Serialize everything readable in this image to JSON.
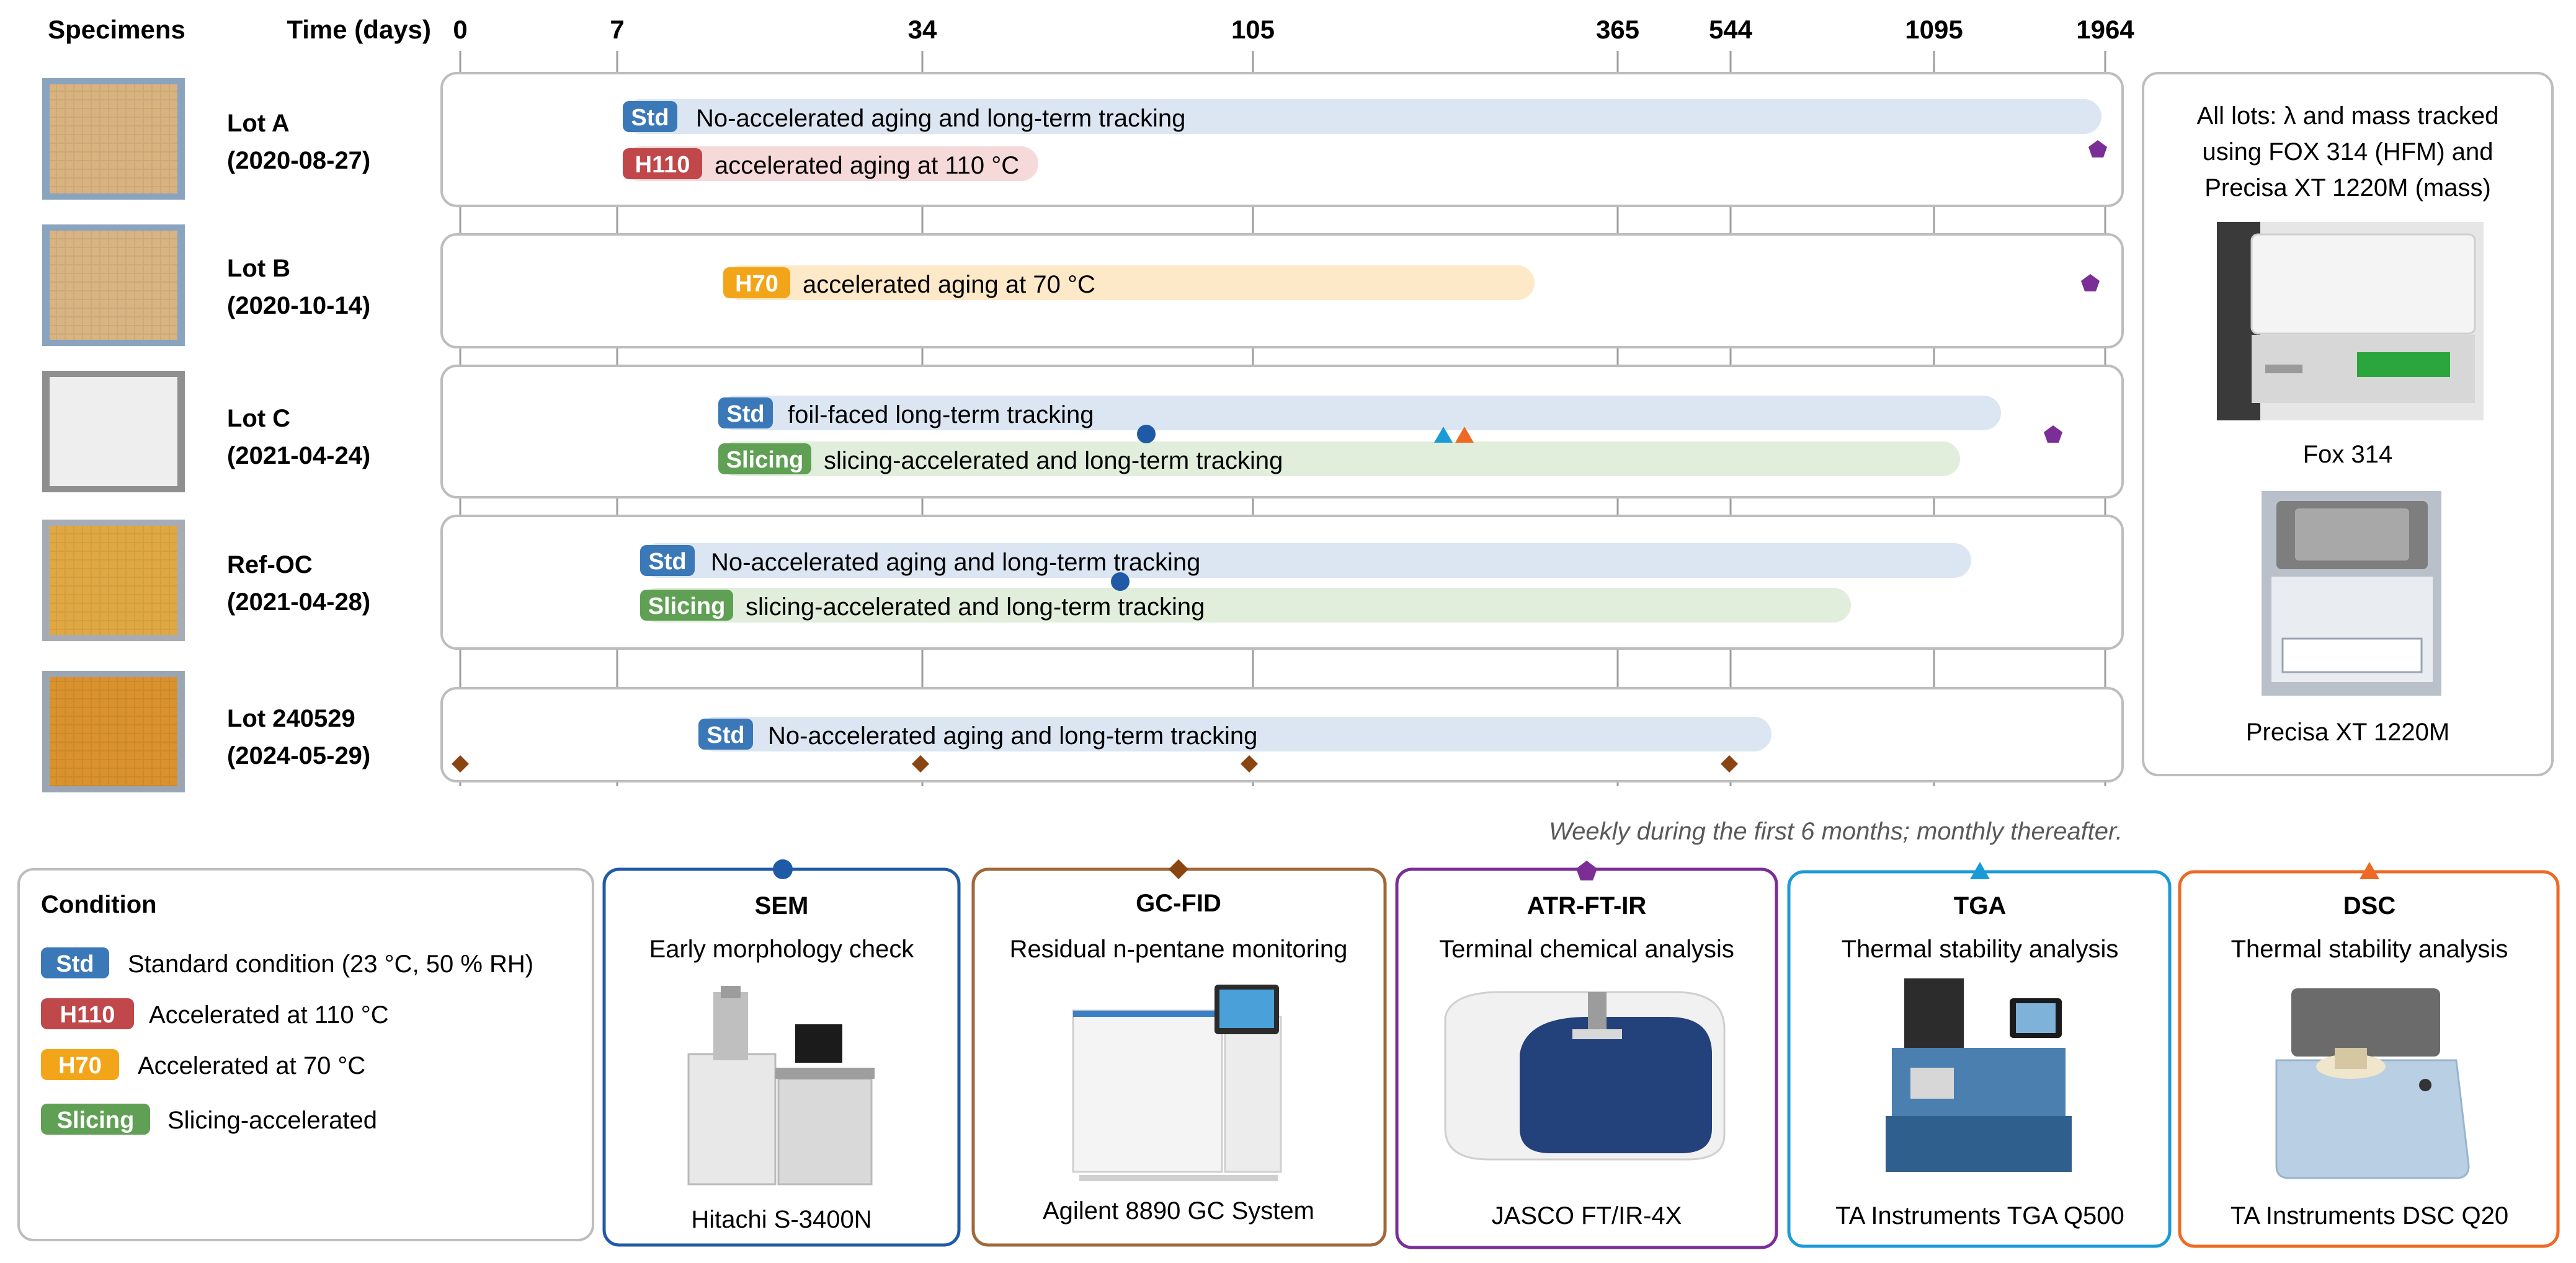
{
  "header": {
    "specimens": "Specimens",
    "time": "Time (days)"
  },
  "ticks": [
    "0",
    "7",
    "34",
    "105",
    "365",
    "544",
    "1095",
    "1964"
  ],
  "lots": [
    {
      "name": "Lot A",
      "date": "(2020-08-27)",
      "tracks": [
        {
          "badge": "Std",
          "label": "No-accelerated aging and long-term tracking"
        },
        {
          "badge": "H110",
          "label": "accelerated aging at 110 °C"
        }
      ]
    },
    {
      "name": "Lot B",
      "date": "(2020-10-14)",
      "tracks": [
        {
          "badge": "H70",
          "label": "accelerated aging at 70 °C"
        }
      ]
    },
    {
      "name": "Lot C",
      "date": "(2021-04-24)",
      "tracks": [
        {
          "badge": "Std",
          "label": "foil-faced long-term tracking"
        },
        {
          "badge": "Slicing",
          "label": "slicing-accelerated and long-term tracking"
        }
      ]
    },
    {
      "name": "Ref-OC",
      "date": "(2021-04-28)",
      "tracks": [
        {
          "badge": "Std",
          "label": "No-accelerated aging and long-term tracking"
        },
        {
          "badge": "Slicing",
          "label": "slicing-accelerated and long-term tracking"
        }
      ]
    },
    {
      "name": "Lot 240529",
      "date": "(2024-05-29)",
      "tracks": [
        {
          "badge": "Std",
          "label": "No-accelerated aging and long-term tracking"
        }
      ]
    }
  ],
  "gc_note": "Weekly during the first 6 months; monthly thereafter.",
  "side_panel": {
    "text": [
      "All lots: λ and mass tracked",
      "using FOX 314 (HFM) and",
      "Precisa XT 1220M (mass)"
    ],
    "inst1": "Fox 314",
    "inst2": "Precisa XT 1220M"
  },
  "legend": {
    "title": "Condition",
    "items": [
      {
        "badge": "Std",
        "label": "Standard condition (23 °C, 50 % RH)"
      },
      {
        "badge": "H110",
        "label": "Accelerated at 110 °C"
      },
      {
        "badge": "H70",
        "label": "Accelerated at 70 °C"
      },
      {
        "badge": "Slicing",
        "label": "Slicing-accelerated"
      }
    ]
  },
  "instruments": [
    {
      "title": "SEM",
      "desc": "Early morphology check",
      "model": "Hitachi S-3400N",
      "icon": "circle-marker-icon",
      "color": "#1f5aa6"
    },
    {
      "title": "GC-FID",
      "desc": "Residual n-pentane monitoring",
      "model": "Agilent 8890 GC System",
      "icon": "diamond-marker-icon",
      "color": "#8b4513"
    },
    {
      "title": "ATR-FT-IR",
      "desc": "Terminal chemical analysis",
      "model": "JASCO FT/IR-4X",
      "icon": "pentagon-marker-icon",
      "color": "#7b2e96"
    },
    {
      "title": "TGA",
      "desc": "Thermal stability analysis",
      "model": "TA Instruments TGA Q500",
      "icon": "triangle-marker-icon",
      "color": "#1a9bd7"
    },
    {
      "title": "DSC",
      "desc": "Thermal stability analysis",
      "model": "TA Instruments DSC Q20",
      "icon": "triangle-marker-icon",
      "color": "#ee6a24"
    }
  ],
  "colors": {
    "Std": "#3b78b8",
    "H110": "#c0474a",
    "H70": "#f3a51a",
    "Slicing": "#5fa054",
    "std_bar": "#dce6f2",
    "h110_bar": "#f6d9d9",
    "h70_bar": "#fde9c8",
    "slicing_bar": "#e1eedb",
    "panel_border": "#bdbdbd",
    "tick_line": "#9e9e9e"
  }
}
